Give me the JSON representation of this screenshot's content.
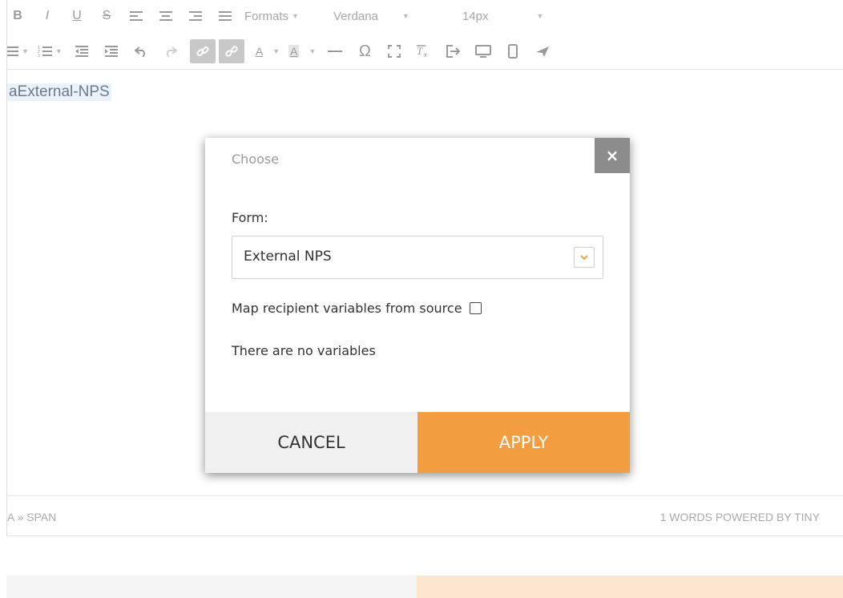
{
  "toolbar": {
    "row1": {
      "bold": "B",
      "italic": "I",
      "underline": "U",
      "strike": "S",
      "formats": "Formats",
      "font": "Verdana",
      "size": "14px"
    },
    "row2": {
      "omega": "Ω",
      "text_color": "A",
      "bg_color": "A"
    }
  },
  "editor": {
    "text": "aExternal-NPS"
  },
  "statusbar": {
    "path": "A » SPAN",
    "words": "1 WORDS POWERED BY TINY"
  },
  "dialog": {
    "title": "Choose",
    "close_label": "×",
    "form_label": "Form:",
    "form_value": "External NPS",
    "map_label": "Map recipient variables from source",
    "map_checked": false,
    "no_variables": "There are no variables",
    "cancel_label": "CANCEL",
    "apply_label": "APPLY"
  },
  "colors": {
    "accent": "#f29d3f",
    "close_bg": "#8c8c8c"
  }
}
